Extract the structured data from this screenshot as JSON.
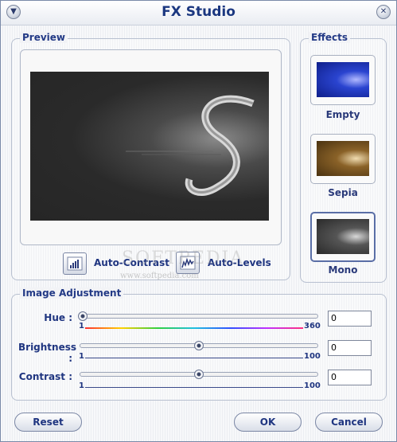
{
  "window": {
    "title": "FX Studio"
  },
  "titlebar": {
    "menu_icon": "chevron-down-icon",
    "close_icon": "close-icon"
  },
  "preview": {
    "label": "Preview",
    "tools": [
      {
        "label": "Auto-Contrast",
        "icon": "auto-contrast-icon"
      },
      {
        "label": "Auto-Levels",
        "icon": "auto-levels-icon"
      }
    ]
  },
  "effects": {
    "label": "Effects",
    "items": [
      {
        "label": "Empty",
        "selected": false,
        "tint": "#1a2e9a"
      },
      {
        "label": "Sepia",
        "selected": false,
        "tint": "#6b4a1e"
      },
      {
        "label": "Mono",
        "selected": true,
        "tint": "#3a3a3a"
      }
    ]
  },
  "adjustment": {
    "label": "Image Adjustment",
    "sliders": [
      {
        "label": "Hue :",
        "min": "1",
        "max": "360",
        "value": "0",
        "position": 0.0
      },
      {
        "label": "Brightness :",
        "min": "1",
        "max": "100",
        "value": "0",
        "position": 0.5
      },
      {
        "label": "Contrast :",
        "min": "1",
        "max": "100",
        "value": "0",
        "position": 0.5
      }
    ]
  },
  "buttons": {
    "reset": "Reset",
    "ok": "OK",
    "cancel": "Cancel"
  },
  "watermark": {
    "line1": "SOFTPEDIA",
    "line2": "www.softpedia.com"
  },
  "colors": {
    "title": "#1b3780",
    "accent": "#233a86",
    "hue_gradient": [
      "#ff3030",
      "#ffd000",
      "#30d040",
      "#20c0e0",
      "#3050ff",
      "#c030ff",
      "#ff3080"
    ]
  }
}
